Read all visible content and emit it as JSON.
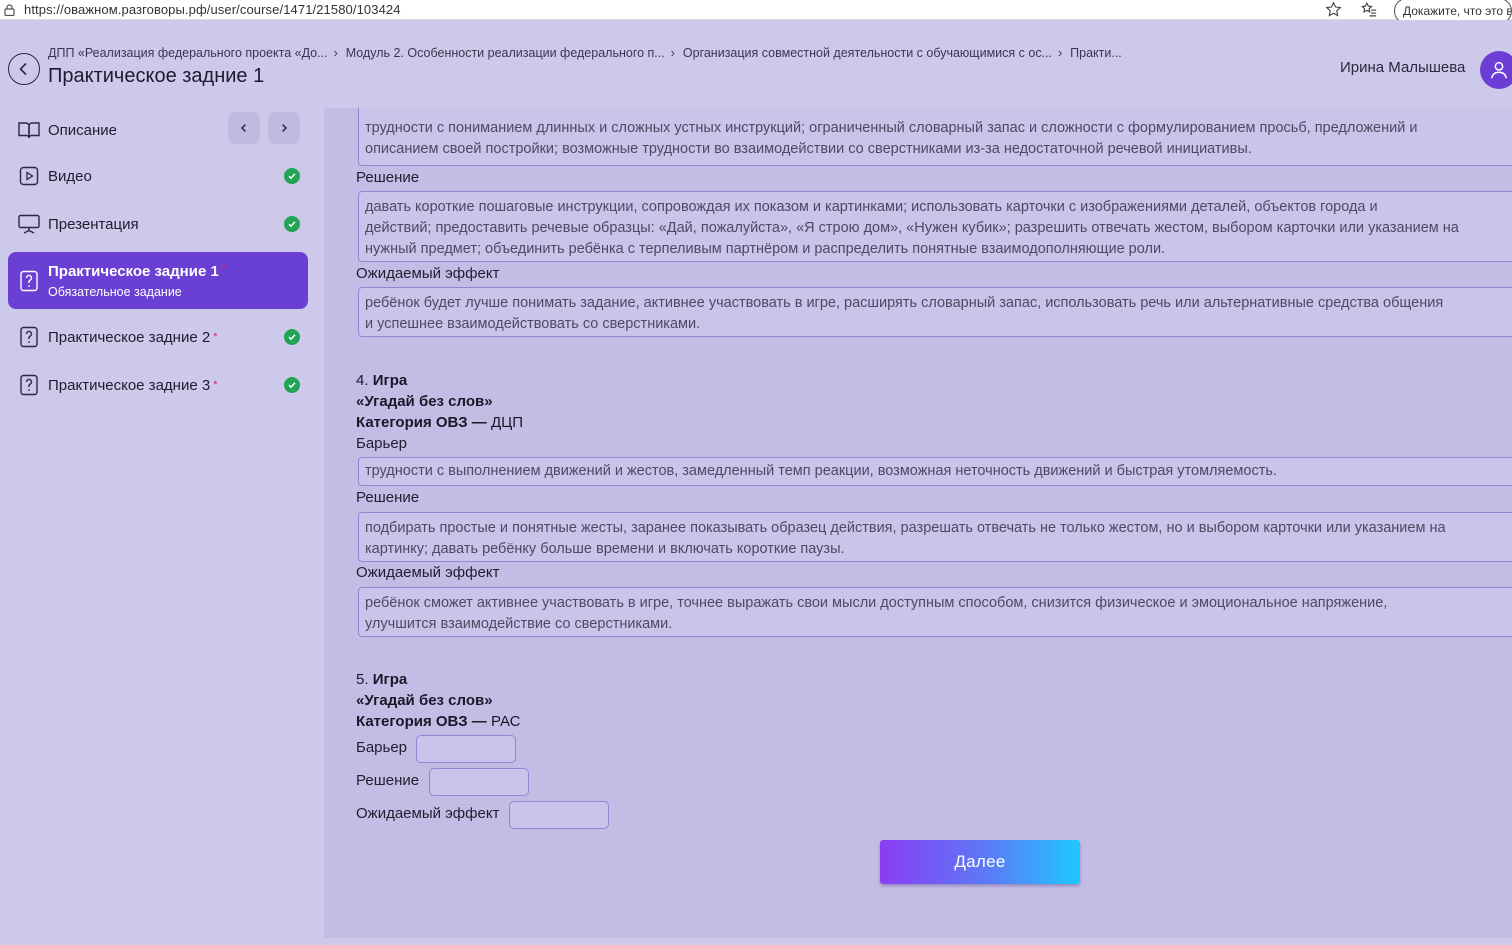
{
  "browser": {
    "url": "https://оважном.разговоры.рф/user/course/1471/21580/103424",
    "ext_button": "Докажите, что это в"
  },
  "header": {
    "breadcrumb": [
      "ДПП «Реализация федерального проекта «До...",
      "Модуль 2. Особенности реализации федерального п...",
      "Организация совместной деятельности с обучающимися с ос...",
      "Практи..."
    ],
    "title": "Практическое задние 1",
    "user_name": "Ирина Малышева"
  },
  "sidebar": {
    "items": [
      {
        "label": "Описание",
        "icon": "book-icon"
      },
      {
        "label": "Видео",
        "icon": "video-icon",
        "done": true
      },
      {
        "label": "Презентация",
        "icon": "presentation-icon",
        "done": true
      },
      {
        "label": "Практическое задние 1",
        "sub": "Обязательное задание",
        "icon": "question-doc-icon",
        "required": "*",
        "active": true
      },
      {
        "label": "Практическое задние 2",
        "icon": "question-doc-icon",
        "required": "*",
        "done": true
      },
      {
        "label": "Практическое задние 3",
        "icon": "question-doc-icon",
        "required": "*",
        "done": true
      }
    ]
  },
  "main": {
    "top_barrier_lines": [
      "трудности с пониманием длинных и сложных устных инструкций; ограниченный словарный запас и сложности с формулированием просьб, предложений и",
      "описанием своей постройки; возможные трудности во взаимодействии со сверстниками из-за недостаточной речевой инициативы."
    ],
    "label_solution": "Решение",
    "label_effect": "Ожидаемый эффект",
    "label_barrier": "Барьер",
    "top_solution_lines": [
      "давать короткие пошаговые инструкции, сопровождая их показом и картинками; использовать карточки с изображениями деталей, объектов города и",
      "действий; предоставить речевые образцы: «Дай, пожалуйста», «Я строю дом», «Нужен кубик»; разрешить отвечать жестом, выбором карточки или указанием на",
      "нужный предмет; объединить ребёнка с терпеливым партнёром и распределить понятные взаимодополняющие роли."
    ],
    "top_effect_lines": [
      "ребёнок будет лучше понимать задание, активнее участвовать в игре, расширять словарный запас, использовать речь или альтернативные средства общения",
      "и успешнее взаимодействовать со сверстниками."
    ],
    "item4": {
      "num": "4.",
      "game": "Игра",
      "name": "«Угадай без слов»",
      "category_label": "Категория ОВЗ —",
      "category": "ДЦП",
      "barrier": "трудности с выполнением движений и жестов, замедленный темп реакции, возможная неточность движений и быстрая утомляемость.",
      "solution_lines": [
        "подбирать простые и понятные жесты, заранее показывать образец действия, разрешать отвечать не только жестом, но и выбором карточки или указанием на",
        "картинку; давать ребёнку больше времени и включать короткие паузы."
      ],
      "effect_lines": [
        "ребёнок сможет активнее участвовать в игре, точнее выражать свои мысли доступным способом, снизится физическое и эмоциональное напряжение,",
        "улучшится взаимодействие со сверстниками."
      ]
    },
    "item5": {
      "num": "5.",
      "game": "Игра",
      "name": "«Угадай без слов»",
      "category_label": "Категория ОВЗ —",
      "category": "РАС"
    },
    "next_button": "Далее"
  }
}
